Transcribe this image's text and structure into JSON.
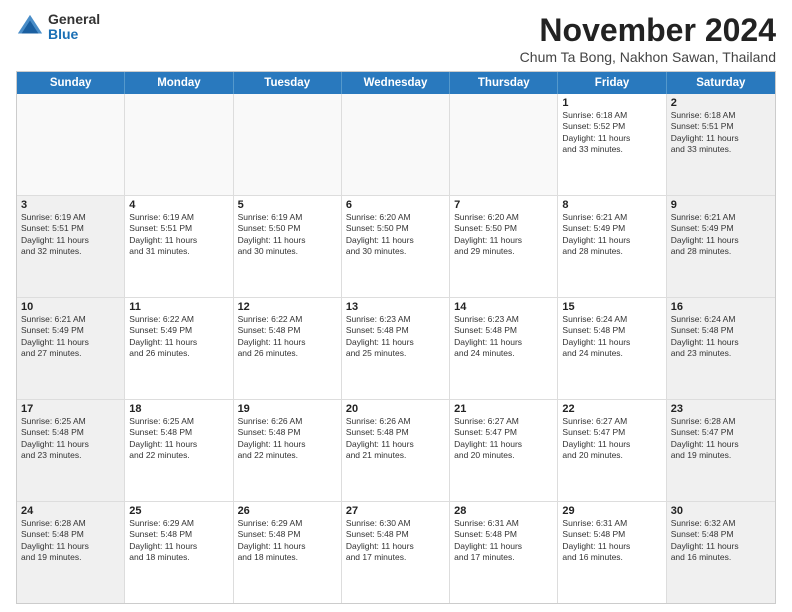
{
  "logo": {
    "general": "General",
    "blue": "Blue"
  },
  "header": {
    "month_title": "November 2024",
    "subtitle": "Chum Ta Bong, Nakhon Sawan, Thailand"
  },
  "calendar": {
    "days_of_week": [
      "Sunday",
      "Monday",
      "Tuesday",
      "Wednesday",
      "Thursday",
      "Friday",
      "Saturday"
    ],
    "rows": [
      {
        "cells": [
          {
            "day": "",
            "empty": true
          },
          {
            "day": "",
            "empty": true
          },
          {
            "day": "",
            "empty": true
          },
          {
            "day": "",
            "empty": true
          },
          {
            "day": "",
            "empty": true
          },
          {
            "day": "1",
            "info": "Sunrise: 6:18 AM\nSunset: 5:52 PM\nDaylight: 11 hours\nand 33 minutes."
          },
          {
            "day": "2",
            "info": "Sunrise: 6:18 AM\nSunset: 5:51 PM\nDaylight: 11 hours\nand 33 minutes."
          }
        ]
      },
      {
        "cells": [
          {
            "day": "3",
            "info": "Sunrise: 6:19 AM\nSunset: 5:51 PM\nDaylight: 11 hours\nand 32 minutes."
          },
          {
            "day": "4",
            "info": "Sunrise: 6:19 AM\nSunset: 5:51 PM\nDaylight: 11 hours\nand 31 minutes."
          },
          {
            "day": "5",
            "info": "Sunrise: 6:19 AM\nSunset: 5:50 PM\nDaylight: 11 hours\nand 30 minutes."
          },
          {
            "day": "6",
            "info": "Sunrise: 6:20 AM\nSunset: 5:50 PM\nDaylight: 11 hours\nand 30 minutes."
          },
          {
            "day": "7",
            "info": "Sunrise: 6:20 AM\nSunset: 5:50 PM\nDaylight: 11 hours\nand 29 minutes."
          },
          {
            "day": "8",
            "info": "Sunrise: 6:21 AM\nSunset: 5:49 PM\nDaylight: 11 hours\nand 28 minutes."
          },
          {
            "day": "9",
            "info": "Sunrise: 6:21 AM\nSunset: 5:49 PM\nDaylight: 11 hours\nand 28 minutes."
          }
        ]
      },
      {
        "cells": [
          {
            "day": "10",
            "info": "Sunrise: 6:21 AM\nSunset: 5:49 PM\nDaylight: 11 hours\nand 27 minutes."
          },
          {
            "day": "11",
            "info": "Sunrise: 6:22 AM\nSunset: 5:49 PM\nDaylight: 11 hours\nand 26 minutes."
          },
          {
            "day": "12",
            "info": "Sunrise: 6:22 AM\nSunset: 5:48 PM\nDaylight: 11 hours\nand 26 minutes."
          },
          {
            "day": "13",
            "info": "Sunrise: 6:23 AM\nSunset: 5:48 PM\nDaylight: 11 hours\nand 25 minutes."
          },
          {
            "day": "14",
            "info": "Sunrise: 6:23 AM\nSunset: 5:48 PM\nDaylight: 11 hours\nand 24 minutes."
          },
          {
            "day": "15",
            "info": "Sunrise: 6:24 AM\nSunset: 5:48 PM\nDaylight: 11 hours\nand 24 minutes."
          },
          {
            "day": "16",
            "info": "Sunrise: 6:24 AM\nSunset: 5:48 PM\nDaylight: 11 hours\nand 23 minutes."
          }
        ]
      },
      {
        "cells": [
          {
            "day": "17",
            "info": "Sunrise: 6:25 AM\nSunset: 5:48 PM\nDaylight: 11 hours\nand 23 minutes."
          },
          {
            "day": "18",
            "info": "Sunrise: 6:25 AM\nSunset: 5:48 PM\nDaylight: 11 hours\nand 22 minutes."
          },
          {
            "day": "19",
            "info": "Sunrise: 6:26 AM\nSunset: 5:48 PM\nDaylight: 11 hours\nand 22 minutes."
          },
          {
            "day": "20",
            "info": "Sunrise: 6:26 AM\nSunset: 5:48 PM\nDaylight: 11 hours\nand 21 minutes."
          },
          {
            "day": "21",
            "info": "Sunrise: 6:27 AM\nSunset: 5:47 PM\nDaylight: 11 hours\nand 20 minutes."
          },
          {
            "day": "22",
            "info": "Sunrise: 6:27 AM\nSunset: 5:47 PM\nDaylight: 11 hours\nand 20 minutes."
          },
          {
            "day": "23",
            "info": "Sunrise: 6:28 AM\nSunset: 5:47 PM\nDaylight: 11 hours\nand 19 minutes."
          }
        ]
      },
      {
        "cells": [
          {
            "day": "24",
            "info": "Sunrise: 6:28 AM\nSunset: 5:48 PM\nDaylight: 11 hours\nand 19 minutes."
          },
          {
            "day": "25",
            "info": "Sunrise: 6:29 AM\nSunset: 5:48 PM\nDaylight: 11 hours\nand 18 minutes."
          },
          {
            "day": "26",
            "info": "Sunrise: 6:29 AM\nSunset: 5:48 PM\nDaylight: 11 hours\nand 18 minutes."
          },
          {
            "day": "27",
            "info": "Sunrise: 6:30 AM\nSunset: 5:48 PM\nDaylight: 11 hours\nand 17 minutes."
          },
          {
            "day": "28",
            "info": "Sunrise: 6:31 AM\nSunset: 5:48 PM\nDaylight: 11 hours\nand 17 minutes."
          },
          {
            "day": "29",
            "info": "Sunrise: 6:31 AM\nSunset: 5:48 PM\nDaylight: 11 hours\nand 16 minutes."
          },
          {
            "day": "30",
            "info": "Sunrise: 6:32 AM\nSunset: 5:48 PM\nDaylight: 11 hours\nand 16 minutes."
          }
        ]
      }
    ]
  }
}
